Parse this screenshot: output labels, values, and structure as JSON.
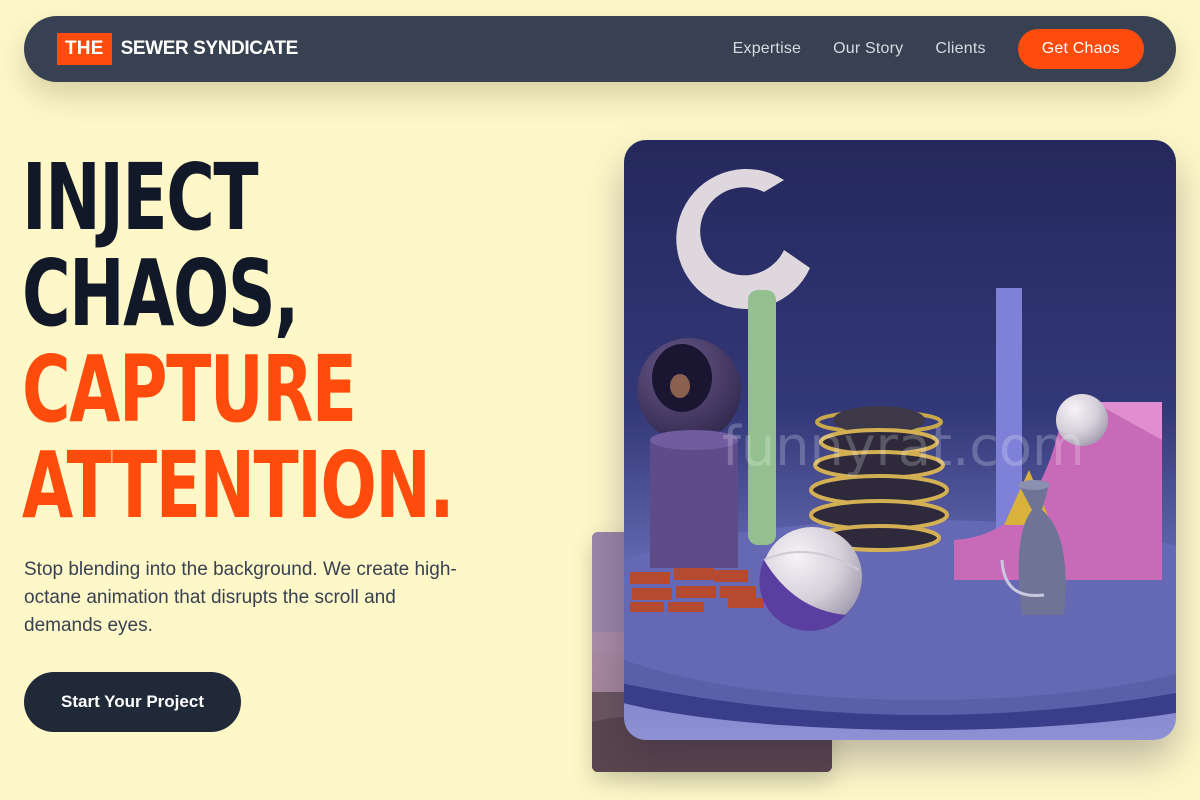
{
  "nav": {
    "logo_box": "THE",
    "logo_text": "SEWER SYNDICATE",
    "links": [
      "Expertise",
      "Our Story",
      "Clients"
    ],
    "cta": "Get Chaos"
  },
  "hero": {
    "headline_lines": [
      "INJECT",
      "CHAOS,",
      "CAPTURE",
      "ATTENTION."
    ],
    "subtext": "Stop blending into the background. We create high-octane animation that disrupts the scroll and demands eyes.",
    "button": "Start Your Project"
  },
  "media": {
    "watermark": "funnyrat.com"
  },
  "colors": {
    "background": "#fef8c9",
    "nav_bg": "#374151",
    "accent": "#ff4c0c",
    "dark_text": "#111827",
    "button_bg": "#1f2937"
  }
}
